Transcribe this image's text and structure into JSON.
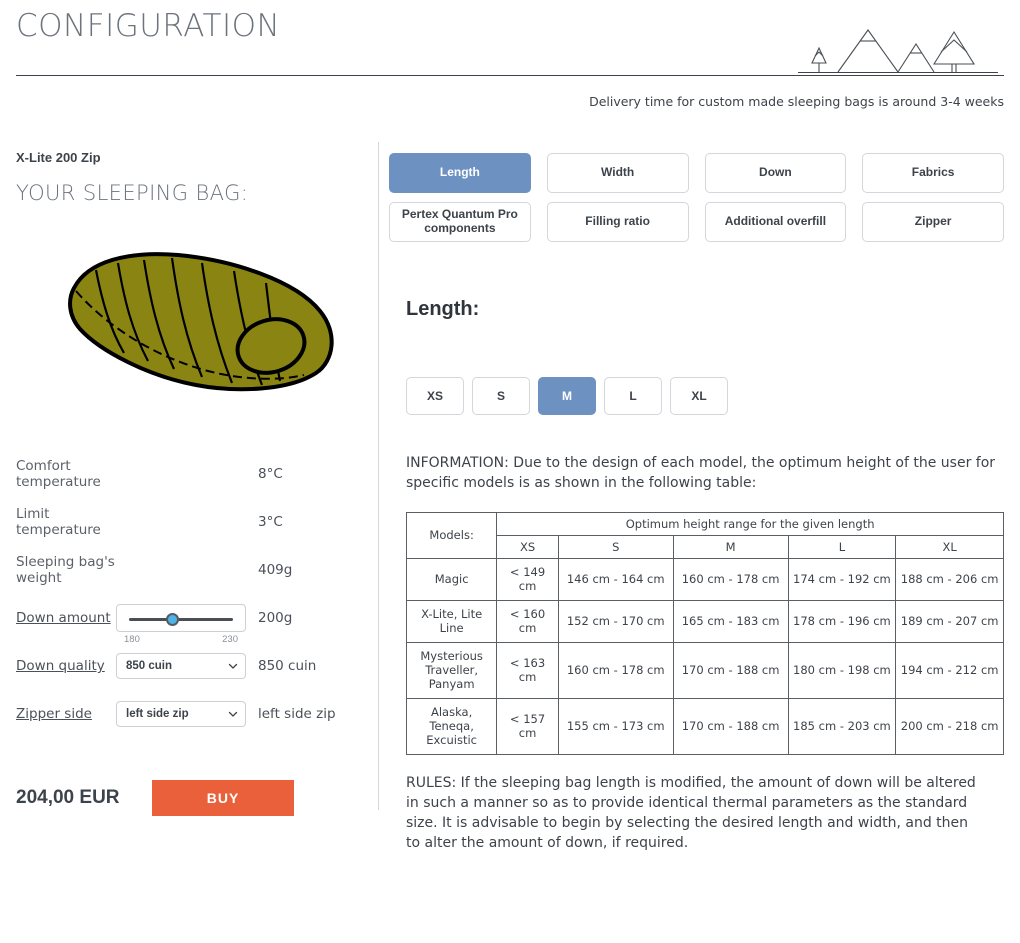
{
  "header": {
    "title": "CONFIGURATION",
    "delivery_note": "Delivery time for custom made sleeping bags is around 3-4 weeks"
  },
  "left": {
    "product_name": "X-Lite 200 Zip",
    "panel_heading": "YOUR SLEEPING BAG:",
    "bag_color": "#8a8512",
    "specs": [
      {
        "label": "Comfort temperature",
        "value": "8°C"
      },
      {
        "label": "Limit temperature",
        "value": "3°C"
      },
      {
        "label": "Sleeping bag's weight",
        "value": "409g"
      }
    ],
    "down_amount": {
      "label": "Down amount",
      "value": "200g",
      "min": "180",
      "max": "230",
      "thumb_percent": 40
    },
    "down_quality": {
      "label": "Down quality",
      "selected": "850 cuin",
      "value": "850 cuin"
    },
    "zipper_side": {
      "label": "Zipper side",
      "selected": "left side zip",
      "value": "left side zip"
    },
    "price": "204,00 EUR",
    "buy_label": "BUY"
  },
  "right": {
    "tabs": [
      {
        "label": "Length",
        "active": true
      },
      {
        "label": "Width",
        "active": false
      },
      {
        "label": "Down",
        "active": false
      },
      {
        "label": "Fabrics",
        "active": false
      },
      {
        "label": "Pertex Quantum Pro components",
        "active": false
      },
      {
        "label": "Filling ratio",
        "active": false
      },
      {
        "label": "Additional overfill",
        "active": false
      },
      {
        "label": "Zipper",
        "active": false
      }
    ],
    "section_title": "Length:",
    "sizes": [
      {
        "label": "XS",
        "active": false
      },
      {
        "label": "S",
        "active": false
      },
      {
        "label": "M",
        "active": true
      },
      {
        "label": "L",
        "active": false
      },
      {
        "label": "XL",
        "active": false
      }
    ],
    "info_text": "INFORMATION: Due to the design of each model, the optimum height of the user for specific models is as shown in the following table:",
    "rules_text": "RULES: If the sleeping bag length is modified, the amount of down will be altered in such a manner so as to provide identical thermal parameters as the standard size. It is advisable to begin by selecting the desired length and width, and then to alter the amount of down, if required.",
    "table": {
      "models_header": "Models:",
      "group_header": "Optimum height range for the given length",
      "columns": [
        "XS",
        "S",
        "M",
        "L",
        "XL"
      ],
      "rows": [
        {
          "model": "Magic",
          "tall": false,
          "cells": [
            "< 149 cm",
            "146 cm - 164 cm",
            "160 cm - 178 cm",
            "174 cm - 192 cm",
            "188 cm - 206 cm"
          ]
        },
        {
          "model": "X-Lite, Lite Line",
          "tall": false,
          "cells": [
            "< 160 cm",
            "152 cm - 170 cm",
            "165 cm - 183 cm",
            "178 cm - 196 cm",
            "189 cm - 207 cm"
          ]
        },
        {
          "model": "Mysterious Traveller, Panyam",
          "tall": true,
          "cells": [
            "< 163 cm",
            "160 cm - 178 cm",
            "170 cm - 188 cm",
            "180 cm - 198 cm",
            "194 cm - 212 cm"
          ]
        },
        {
          "model": "Alaska, Teneqa, Excuistic",
          "tall": true,
          "cells": [
            "< 157 cm",
            "155 cm - 173 cm",
            "170 cm - 188 cm",
            "185 cm - 203 cm",
            "200 cm - 218 cm"
          ]
        }
      ]
    }
  },
  "colors": {
    "accent_blue": "#6d92c1",
    "buy_orange": "#e9603a",
    "slider_thumb": "#4fb3e8",
    "text": "#3d434a"
  }
}
